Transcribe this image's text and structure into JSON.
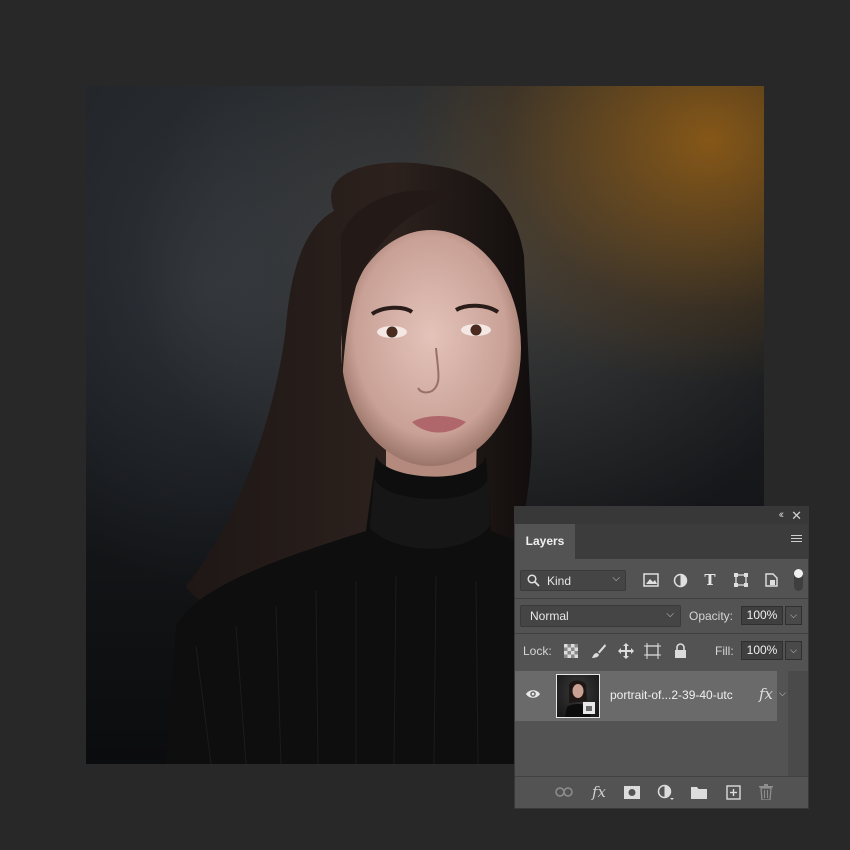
{
  "panel": {
    "collapse_glyph": "‹‹",
    "close_glyph": "✕",
    "tab_label": "Layers",
    "filter": {
      "kind_label": "Kind",
      "icons": [
        "image-filter-icon",
        "adjustment-filter-icon",
        "type-filter-icon",
        "shape-filter-icon",
        "smart-object-filter-icon"
      ],
      "type_glyph": "T"
    },
    "blend_mode": "Normal",
    "opacity_label": "Opacity:",
    "opacity_value": "100%",
    "lock_label": "Lock:",
    "fill_label": "Fill:",
    "fill_value": "100%",
    "layer": {
      "name": "portrait-of...2-39-40-utc",
      "fx": "fx",
      "visible": true
    },
    "footer_icons": [
      "link-layers-icon",
      "add-layer-style-icon",
      "add-mask-icon",
      "new-adjustment-layer-icon",
      "new-group-icon",
      "new-layer-icon",
      "delete-layer-icon"
    ],
    "footer_fx": "fx"
  },
  "colors": {
    "app_background": "#282828",
    "panel_background": "#535353",
    "panel_header": "#383838",
    "selected_layer": "#6a6a6a"
  }
}
